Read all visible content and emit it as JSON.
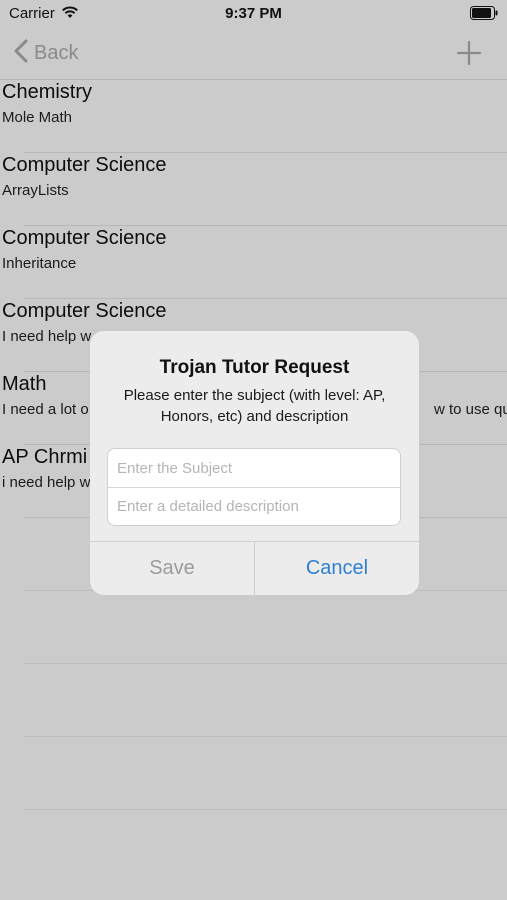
{
  "status_bar": {
    "carrier": "Carrier",
    "time": "9:37 PM",
    "icons": [
      "wifi-icon",
      "battery-icon"
    ]
  },
  "nav": {
    "back_label": "Back",
    "add_icon": "plus-icon",
    "back_icon": "chevron-left-icon"
  },
  "list": {
    "items": [
      {
        "title": "Chemistry",
        "subtitle": "Mole Math"
      },
      {
        "title": "Computer Science",
        "subtitle": "ArrayLists"
      },
      {
        "title": "Computer Science",
        "subtitle": "Inheritance"
      },
      {
        "title": "Computer Science",
        "subtitle": "I need help w"
      },
      {
        "title": "Math",
        "subtitle": "I need a lot o",
        "subtitle_right": "w to use qua"
      },
      {
        "title": "AP Chrmi",
        "subtitle": "i need help w"
      }
    ]
  },
  "dialog": {
    "title": "Trojan Tutor Request",
    "message": "Please enter the subject (with level: AP, Honors, etc) and description",
    "subject_placeholder": "Enter the Subject",
    "description_placeholder": "Enter a detailed description",
    "save_label": "Save",
    "cancel_label": "Cancel"
  },
  "colors": {
    "dimmed_background": "#cbcbcb",
    "dialog_background": "#ececec",
    "accent": "#2f7fd4",
    "disabled_action": "#9b9b9b"
  }
}
